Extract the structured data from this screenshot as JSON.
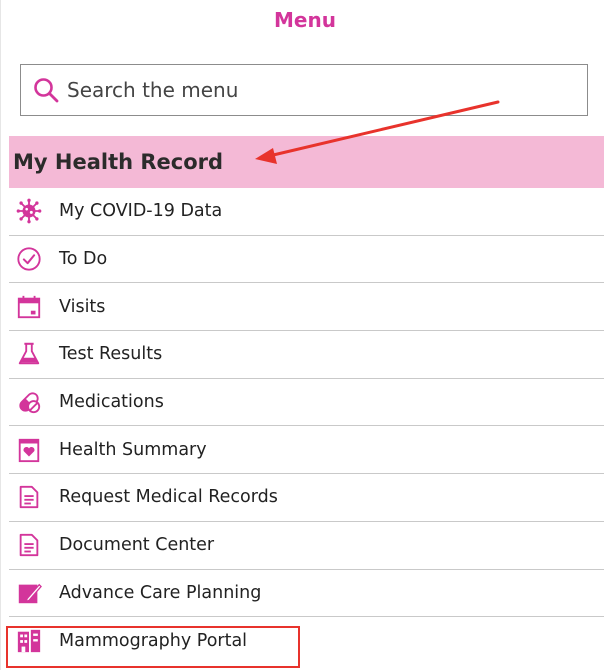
{
  "header": {
    "title": "Menu"
  },
  "search": {
    "placeholder": "Search the menu",
    "icon": "search-icon"
  },
  "section": {
    "title": "My Health Record"
  },
  "colors": {
    "accent": "#d3359b",
    "section_bg": "#f4b9d6",
    "annotation": "#e8332c"
  },
  "menu_items": [
    {
      "label": "My COVID-19 Data",
      "icon": "virus-icon"
    },
    {
      "label": "To Do",
      "icon": "check-clock-icon"
    },
    {
      "label": "Visits",
      "icon": "calendar-icon"
    },
    {
      "label": "Test Results",
      "icon": "flask-icon"
    },
    {
      "label": "Medications",
      "icon": "pill-icon"
    },
    {
      "label": "Health Summary",
      "icon": "heart-clipboard-icon"
    },
    {
      "label": "Request Medical Records",
      "icon": "document-icon"
    },
    {
      "label": "Document Center",
      "icon": "document-icon"
    },
    {
      "label": "Advance Care Planning",
      "icon": "notebook-pen-icon"
    },
    {
      "label": "Mammography Portal",
      "icon": "hospital-building-icon"
    }
  ]
}
